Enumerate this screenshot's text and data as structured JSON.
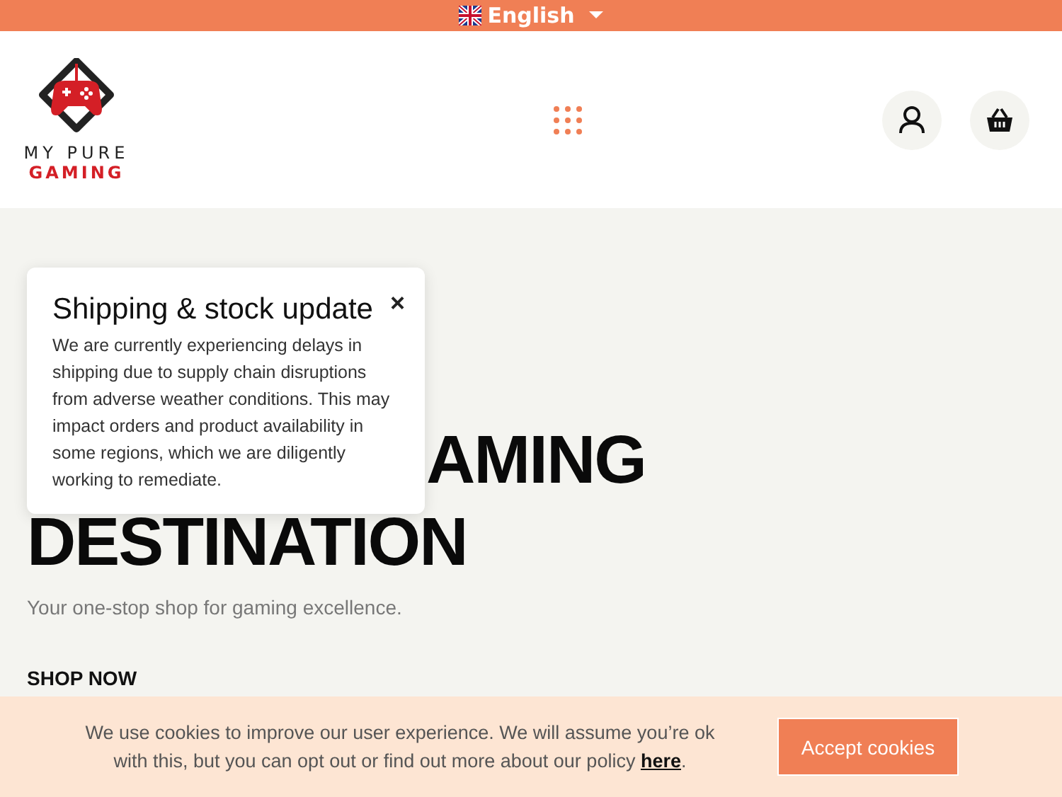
{
  "language_bar": {
    "label": "English"
  },
  "header": {
    "logo": {
      "line1": "MY PURE",
      "line2": "GAMING"
    }
  },
  "hero": {
    "heading_lines": [
      "AMING",
      "DESTINATION"
    ],
    "subtitle": "Your one-stop shop for gaming excellence.",
    "cta": "SHOP NOW"
  },
  "popup": {
    "title": "Shipping & stock update",
    "close": "×",
    "body": "We are currently experiencing delays in shipping due to supply chain disruptions from adverse weather conditions. This may impact orders and product availability in some regions, which we are diligently working to remediate."
  },
  "cookie_bar": {
    "text": "We use cookies to improve our user experience. We will assume you’re ok with this, but you can opt out or find out more about our policy",
    "link": "here",
    "end": ".",
    "button": "Accept cookies"
  }
}
